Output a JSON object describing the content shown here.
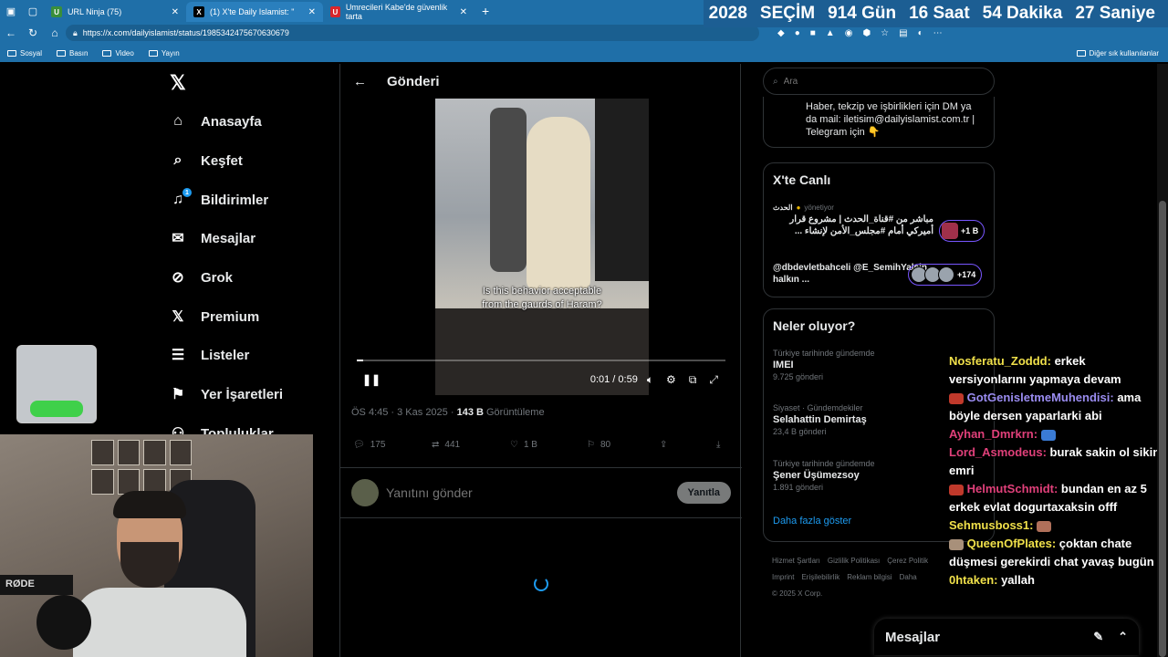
{
  "browser": {
    "tabs": [
      {
        "label": "URL Ninja (75)",
        "fav_bg": "#3a8f3a",
        "fav_text": "UN"
      },
      {
        "label": "(1) X'te Daily Islamist: \"",
        "fav_bg": "#000000",
        "fav_text": "X"
      },
      {
        "label": "Umrecileri Kabe'de güvenlik tarta",
        "fav_bg": "#d9262a",
        "fav_text": "U"
      }
    ],
    "url": "https://x.com/dailyislamist/status/1985342475670630679",
    "bookmarks": [
      "Sosyal",
      "Basın",
      "Video",
      "Yayın"
    ],
    "bookmarks_other": "Diğer sık kullanılanlar"
  },
  "countdown": {
    "year": "2028",
    "label": "SEÇİM",
    "days": "914 Gün",
    "hours": "16 Saat",
    "minutes": "54 Dakika",
    "seconds": "27 Saniye"
  },
  "sidebar": {
    "items": [
      {
        "label": "Anasayfa",
        "icon": "home-icon"
      },
      {
        "label": "Keşfet",
        "icon": "search-icon"
      },
      {
        "label": "Bildirimler",
        "icon": "bell-icon",
        "badge": "1"
      },
      {
        "label": "Mesajlar",
        "icon": "mail-icon"
      },
      {
        "label": "Grok",
        "icon": "grok-icon"
      },
      {
        "label": "Premium",
        "icon": "x-icon"
      },
      {
        "label": "Listeler",
        "icon": "list-icon"
      },
      {
        "label": "Yer İşaretleri",
        "icon": "bookmark-icon"
      },
      {
        "label": "Topluluklar",
        "icon": "people-icon"
      }
    ]
  },
  "post": {
    "header_title": "Gönderi",
    "subtitle_line1": "Is this behavior acceptable",
    "subtitle_line2": "from the gaurds of Haram?",
    "time_display": "0:01 / 0:59",
    "progress_fraction": 0.017,
    "timestamp": "ÖS 4:45 · 3 Kas 2025 · ",
    "views_count": "143 B",
    "views_label": " Görüntüleme",
    "replies": "175",
    "reposts": "441",
    "likes": "1 B",
    "bookmarks": "80",
    "reply_placeholder": "Yanıtını gönder",
    "reply_button": "Yanıtla"
  },
  "right": {
    "search_placeholder": "Ara",
    "bio_line1": "Haber, tekzip ve işbirlikleri için DM ya",
    "bio_line2": "da mail: iletisim@dailyislamist.com.tr |",
    "bio_line3": "Telegram için 👇",
    "live_title": "X'te Canlı",
    "live": [
      {
        "host": "الحدث",
        "host_suffix": "yönetiyor",
        "title": "مباشر من #قناة_الحدث | مشروع قرار أميركي أمام #مجلس_الأمن لإنشاء ...",
        "pill": "+1 B"
      },
      {
        "host": "",
        "host_suffix": "",
        "title": "@dbdevletbahceli @E_SemihYalcin halkın ...",
        "pill": "+174"
      }
    ],
    "trends_title": "Neler oluyor?",
    "trends": [
      {
        "context": "Türkiye tarihinde gündemde",
        "name": "IMEI",
        "count": "9.725 gönderi"
      },
      {
        "context": "Siyaset · Gündemdekiler",
        "name": "Selahattin Demirtaş",
        "count": "23,4 B gönderi"
      },
      {
        "context": "Türkiye tarihinde gündemde",
        "name": "Şener Üşümezsoy",
        "count": "1.891 gönderi"
      }
    ],
    "show_more": "Daha fazla göster",
    "footer_line1": [
      "Hizmet Şartları",
      "Gizlilik Politikası",
      "Çerez Politik"
    ],
    "footer_line2": [
      "Imprint",
      "Erişilebilirlik",
      "Reklam bilgisi",
      "Daha"
    ],
    "copyright": "© 2025 X Corp."
  },
  "chat": [
    {
      "user": "Nosferatu_Zoddd:",
      "color": "#f0e04a",
      "text": " erkek versiyonlarını yapmaya devam"
    },
    {
      "user": "GotGenisletmeMuhendisi:",
      "color": "#9a8cf0",
      "text": " ama böyle dersen yaparlarki abi"
    },
    {
      "user": "Ayhan_Dmrkrn:",
      "color": "#e0407a",
      "text": ""
    },
    {
      "user": "Lord_Asmodeus:",
      "color": "#e0407a",
      "text": " burak sakin ol sikin emri"
    },
    {
      "user": "HelmutSchmidt:",
      "color": "#e0407a",
      "text": " bundan en az 5 erkek evlat dogurtaxaksin offf"
    },
    {
      "user": "Sehmusboss1:",
      "color": "#f0e04a",
      "text": ""
    },
    {
      "user": "QueenOfPlates:",
      "color": "#f0e04a",
      "text": " çoktan chate düşmesi gerekirdi chat yavaş bugün"
    },
    {
      "user": "0htaken:",
      "color": "#f0e04a",
      "text": " yallah"
    }
  ],
  "webcam": {
    "mic_brand": "RØDE"
  },
  "messages_drawer": {
    "label": "Mesajlar"
  }
}
